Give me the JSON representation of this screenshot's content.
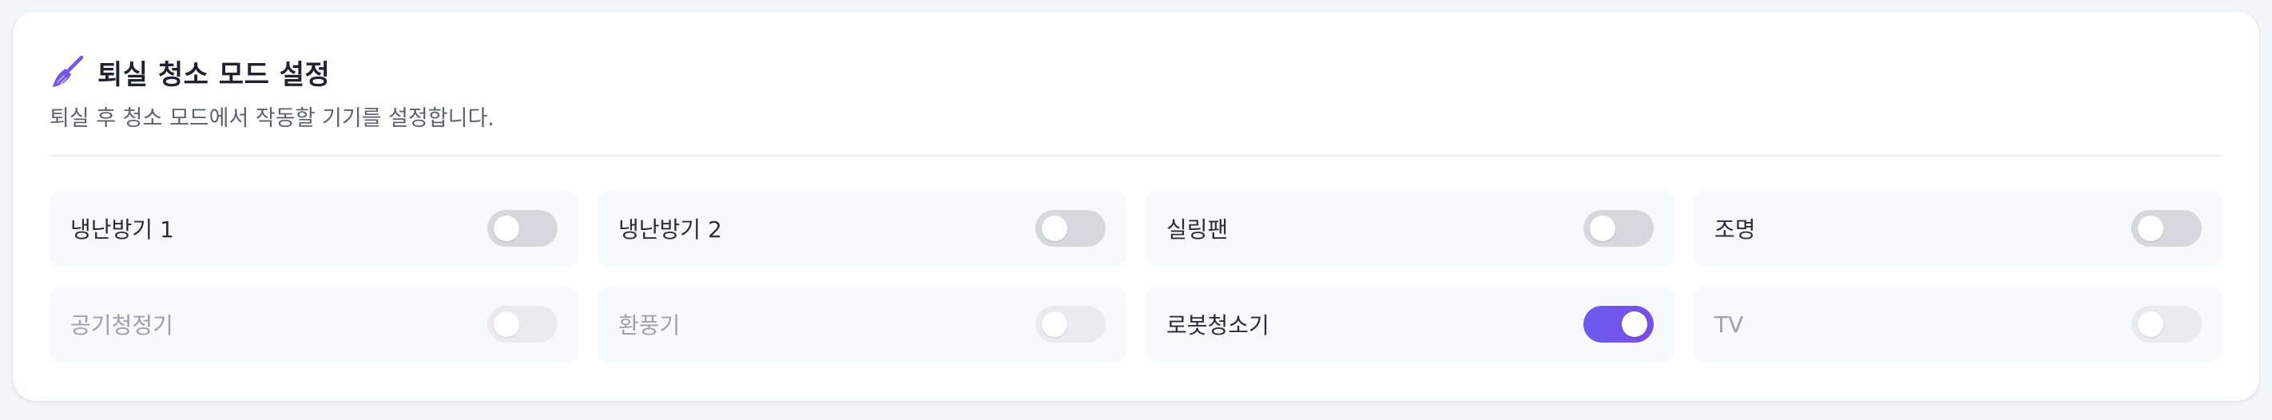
{
  "header": {
    "icon": "broom-icon",
    "title": "퇴실 청소 모드 설정",
    "subtitle": "퇴실 후 청소 모드에서 작동할 기기를 설정합니다."
  },
  "colors": {
    "accent_start": "#6a5cf2",
    "accent_end": "#7b4de8",
    "toggle_off": "#d6d8dd",
    "toggle_disabled": "#e9ebee"
  },
  "devices": [
    {
      "label": "냉난방기 1",
      "enabled": true,
      "on": false
    },
    {
      "label": "냉난방기 2",
      "enabled": true,
      "on": false
    },
    {
      "label": "실링팬",
      "enabled": true,
      "on": false
    },
    {
      "label": "조명",
      "enabled": true,
      "on": false
    },
    {
      "label": "공기청정기",
      "enabled": false,
      "on": false
    },
    {
      "label": "환풍기",
      "enabled": false,
      "on": false
    },
    {
      "label": "로봇청소기",
      "enabled": true,
      "on": true
    },
    {
      "label": "TV",
      "enabled": false,
      "on": false
    }
  ]
}
